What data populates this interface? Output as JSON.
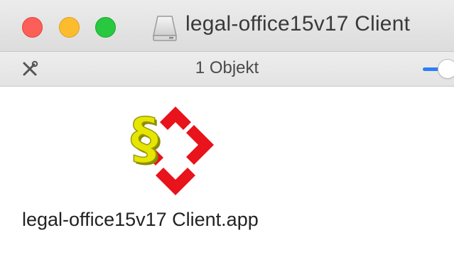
{
  "window": {
    "title": "legal-office15v17 Client"
  },
  "toolbar": {
    "status": "1 Objekt"
  },
  "items": [
    {
      "label": "legal-office15v17 Client.app",
      "icon": "legal-office-app-icon"
    }
  ],
  "icons": {
    "title": "disk-icon",
    "tools": "tools-icon"
  },
  "colors": {
    "close": "#fc5f57",
    "minimize": "#fdbc2e",
    "maximize": "#28c840",
    "slider_accent": "#2f7df6",
    "app_red": "#e8131b",
    "app_yellow": "#e6e600"
  }
}
